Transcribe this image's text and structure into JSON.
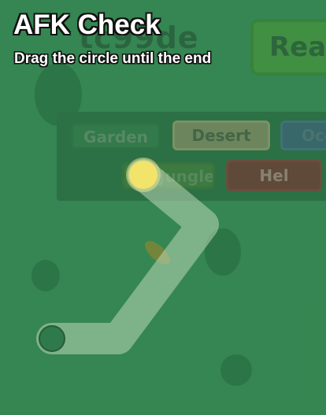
{
  "afk_check": {
    "title": "AFK Check",
    "instruction": "Drag the circle until the end",
    "progress": 0,
    "colors": {
      "path": "#b9d7b5",
      "path_opacity": 0.55,
      "handle": "#f2e36a",
      "handle_glow": "#fff5a0",
      "end_marker": "#2f7a4a"
    }
  },
  "background_game": {
    "username": "tc99de",
    "ready_button_label": "Ready",
    "biomes": [
      {
        "id": "garden",
        "label": "Garden"
      },
      {
        "id": "desert",
        "label": "Desert"
      },
      {
        "id": "ocean",
        "label": "Ocean"
      },
      {
        "id": "jungle",
        "label": "Jungle"
      },
      {
        "id": "hel",
        "label": "Hel"
      }
    ],
    "colors": {
      "field": "#3a8d56",
      "panel": "#2c6b42"
    }
  }
}
